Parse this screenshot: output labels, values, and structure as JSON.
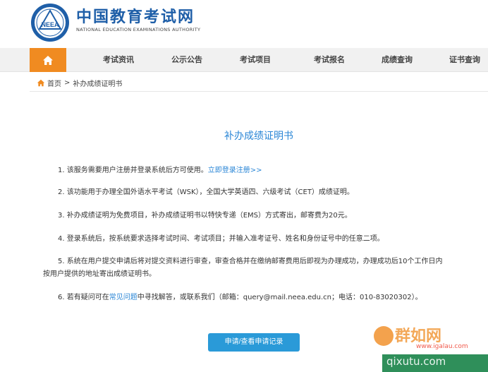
{
  "header": {
    "site_name": "中国教育考试网",
    "site_subtitle": "NATIONAL EDUCATION EXAMINATIONS AUTHORITY",
    "seal_letters": "NEEA"
  },
  "nav": {
    "home_icon": "home-icon",
    "items": [
      "考试资讯",
      "公示公告",
      "考试项目",
      "考试报名",
      "成绩查询",
      "证书查询"
    ]
  },
  "breadcrumb": {
    "home": "首页",
    "separator": ">",
    "current": "补办成绩证明书"
  },
  "page": {
    "title": "补办成绩证明书",
    "items": [
      {
        "text": "1. 该服务需要用户注册并登录系统后方可使用。",
        "link": "立即登录注册>>"
      },
      {
        "text": "2. 该功能用于办理全国外语水平考试（WSK），全国大学英语四、六级考试（CET）成绩证明。"
      },
      {
        "text": "3. 补办成绩证明为免费项目，补办成绩证明书以特快专递（EMS）方式寄出，邮寄费为20元。"
      },
      {
        "text": "4. 登录系统后，按系统要求选择考试时间、考试项目；并输入准考证号、姓名和身份证号中的任意二项。"
      },
      {
        "text": "5. 系统在用户提交申请后将对提交资料进行审查，审查合格并在缴纳邮寄费用后即视为办理成功，办理成功后10个工作日内",
        "line2": "按用户提供的地址寄出成绩证明书。"
      },
      {
        "text_before": "6. 若有疑问可在",
        "link": "常见问题",
        "text_after": "中寻找解答，或联系我们（邮箱：query@mail.neea.edu.cn；电话：010-83020302）。"
      }
    ],
    "apply_button": "申请/查看申请记录"
  },
  "watermark": {
    "brand": "群如网",
    "url": "www.igalau.com",
    "band": "qixutu.com"
  },
  "colors": {
    "brand_blue": "#1f5fa8",
    "link_blue": "#2a86d6",
    "nav_orange": "#f08b21",
    "button_blue": "#2a9ad8"
  }
}
